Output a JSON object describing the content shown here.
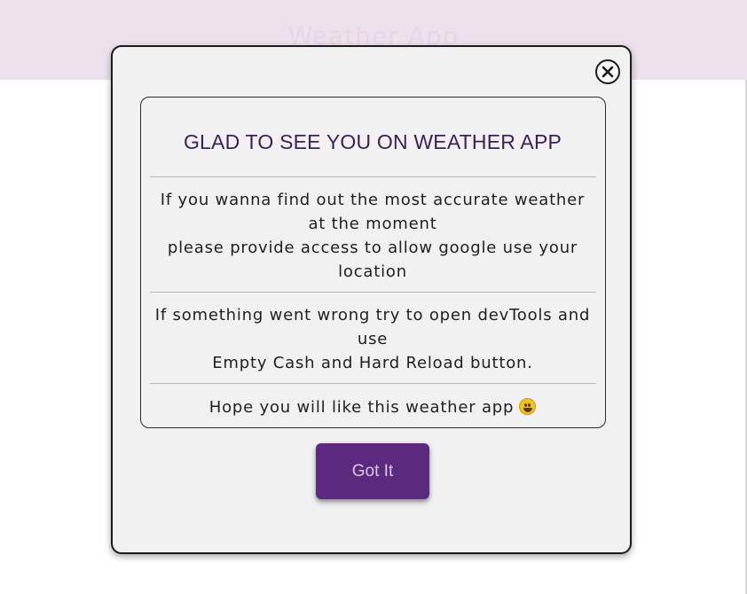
{
  "app": {
    "title": "Weather App"
  },
  "modal": {
    "close_icon": "close-icon",
    "heading": "GLAD TO SEE YOU ON WEATHER APP",
    "paragraph1_line1": "If you wanna find out the most accurate weather at the moment",
    "paragraph1_line2": "please provide access to allow google use your location",
    "paragraph2_line1": "If something went wrong try to open devTools and use",
    "paragraph2_line2": "Empty Cash and Hard Reload button.",
    "paragraph3": "Hope you will like this weather app",
    "emoji_icon": "smiling-face-icon",
    "button_label": "Got It"
  },
  "colors": {
    "accent": "#5b2a7e",
    "heading": "#3c1f57",
    "header_bg": "#ece1ec",
    "modal_bg": "#f2f1f2"
  }
}
